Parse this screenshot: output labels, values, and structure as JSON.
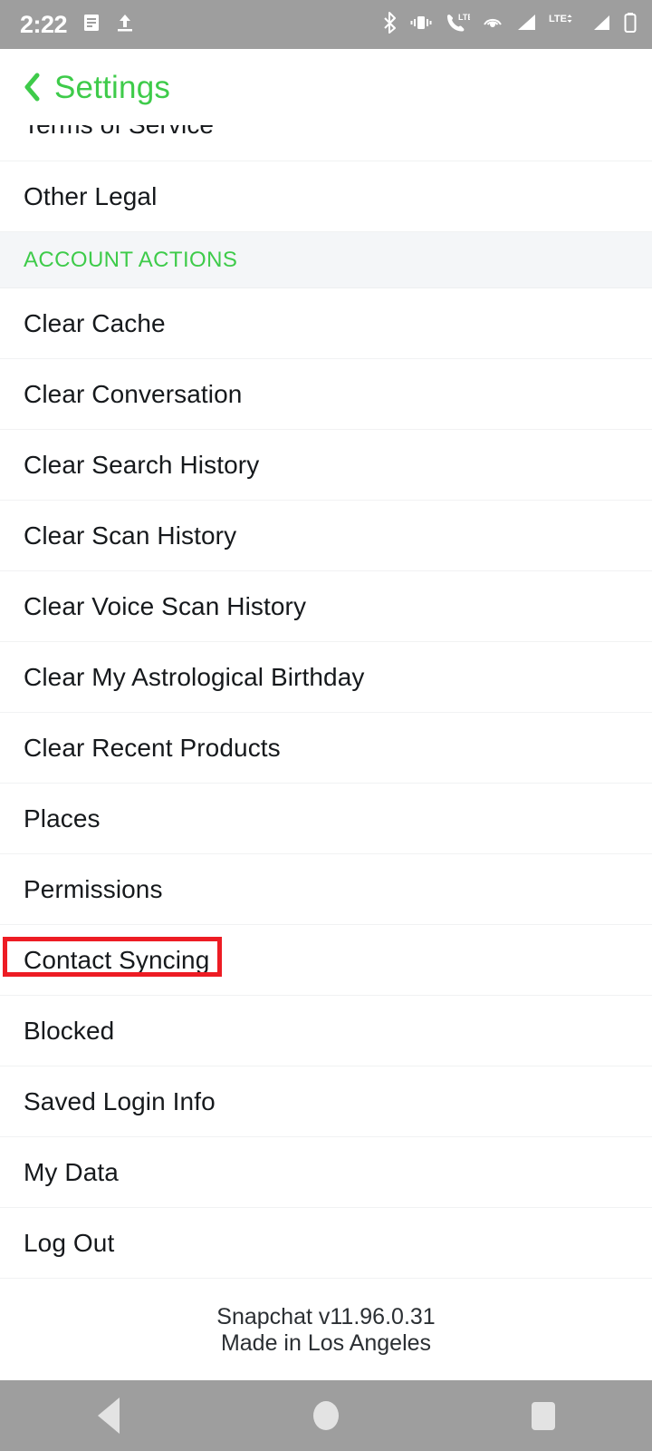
{
  "status_bar": {
    "time": "2:22",
    "left_icons": [
      "notes-icon",
      "upload-icon"
    ],
    "right_icons": [
      "bluetooth-icon",
      "vibrate-icon",
      "volte-call-icon",
      "hotspot-icon",
      "signal-bars-icon",
      "lte-data-icon",
      "signal-bars-2-icon",
      "battery-icon"
    ],
    "background_color": "#9e9e9e"
  },
  "header": {
    "back_icon": "chevron-left-icon",
    "title": "Settings",
    "accent_color": "#3ecb4a"
  },
  "list": {
    "clipped_top_item": "Terms of Service",
    "items_before_section": [
      {
        "label": "Other Legal"
      }
    ],
    "section": {
      "title": "ACCOUNT ACTIONS",
      "background_color": "#f4f6f8",
      "text_color": "#3ecb4a"
    },
    "items": [
      {
        "label": "Clear Cache",
        "highlighted": false
      },
      {
        "label": "Clear Conversation",
        "highlighted": false
      },
      {
        "label": "Clear Search History",
        "highlighted": false
      },
      {
        "label": "Clear Scan History",
        "highlighted": false
      },
      {
        "label": "Clear Voice Scan History",
        "highlighted": false
      },
      {
        "label": "Clear My Astrological Birthday",
        "highlighted": false
      },
      {
        "label": "Clear Recent Products",
        "highlighted": false
      },
      {
        "label": "Places",
        "highlighted": false
      },
      {
        "label": "Permissions",
        "highlighted": false
      },
      {
        "label": "Contact Syncing",
        "highlighted": true
      },
      {
        "label": "Blocked",
        "highlighted": false
      },
      {
        "label": "Saved Login Info",
        "highlighted": false
      },
      {
        "label": "My Data",
        "highlighted": false
      },
      {
        "label": "Log Out",
        "highlighted": false
      }
    ],
    "highlight_color": "#ed1c24"
  },
  "footer": {
    "version": "Snapchat v11.96.0.31",
    "made_in": "Made in Los Angeles"
  },
  "nav_bar": {
    "back": "back-triangle-icon",
    "home": "home-circle-icon",
    "recents": "recents-square-icon",
    "background_color": "#9e9e9e"
  }
}
